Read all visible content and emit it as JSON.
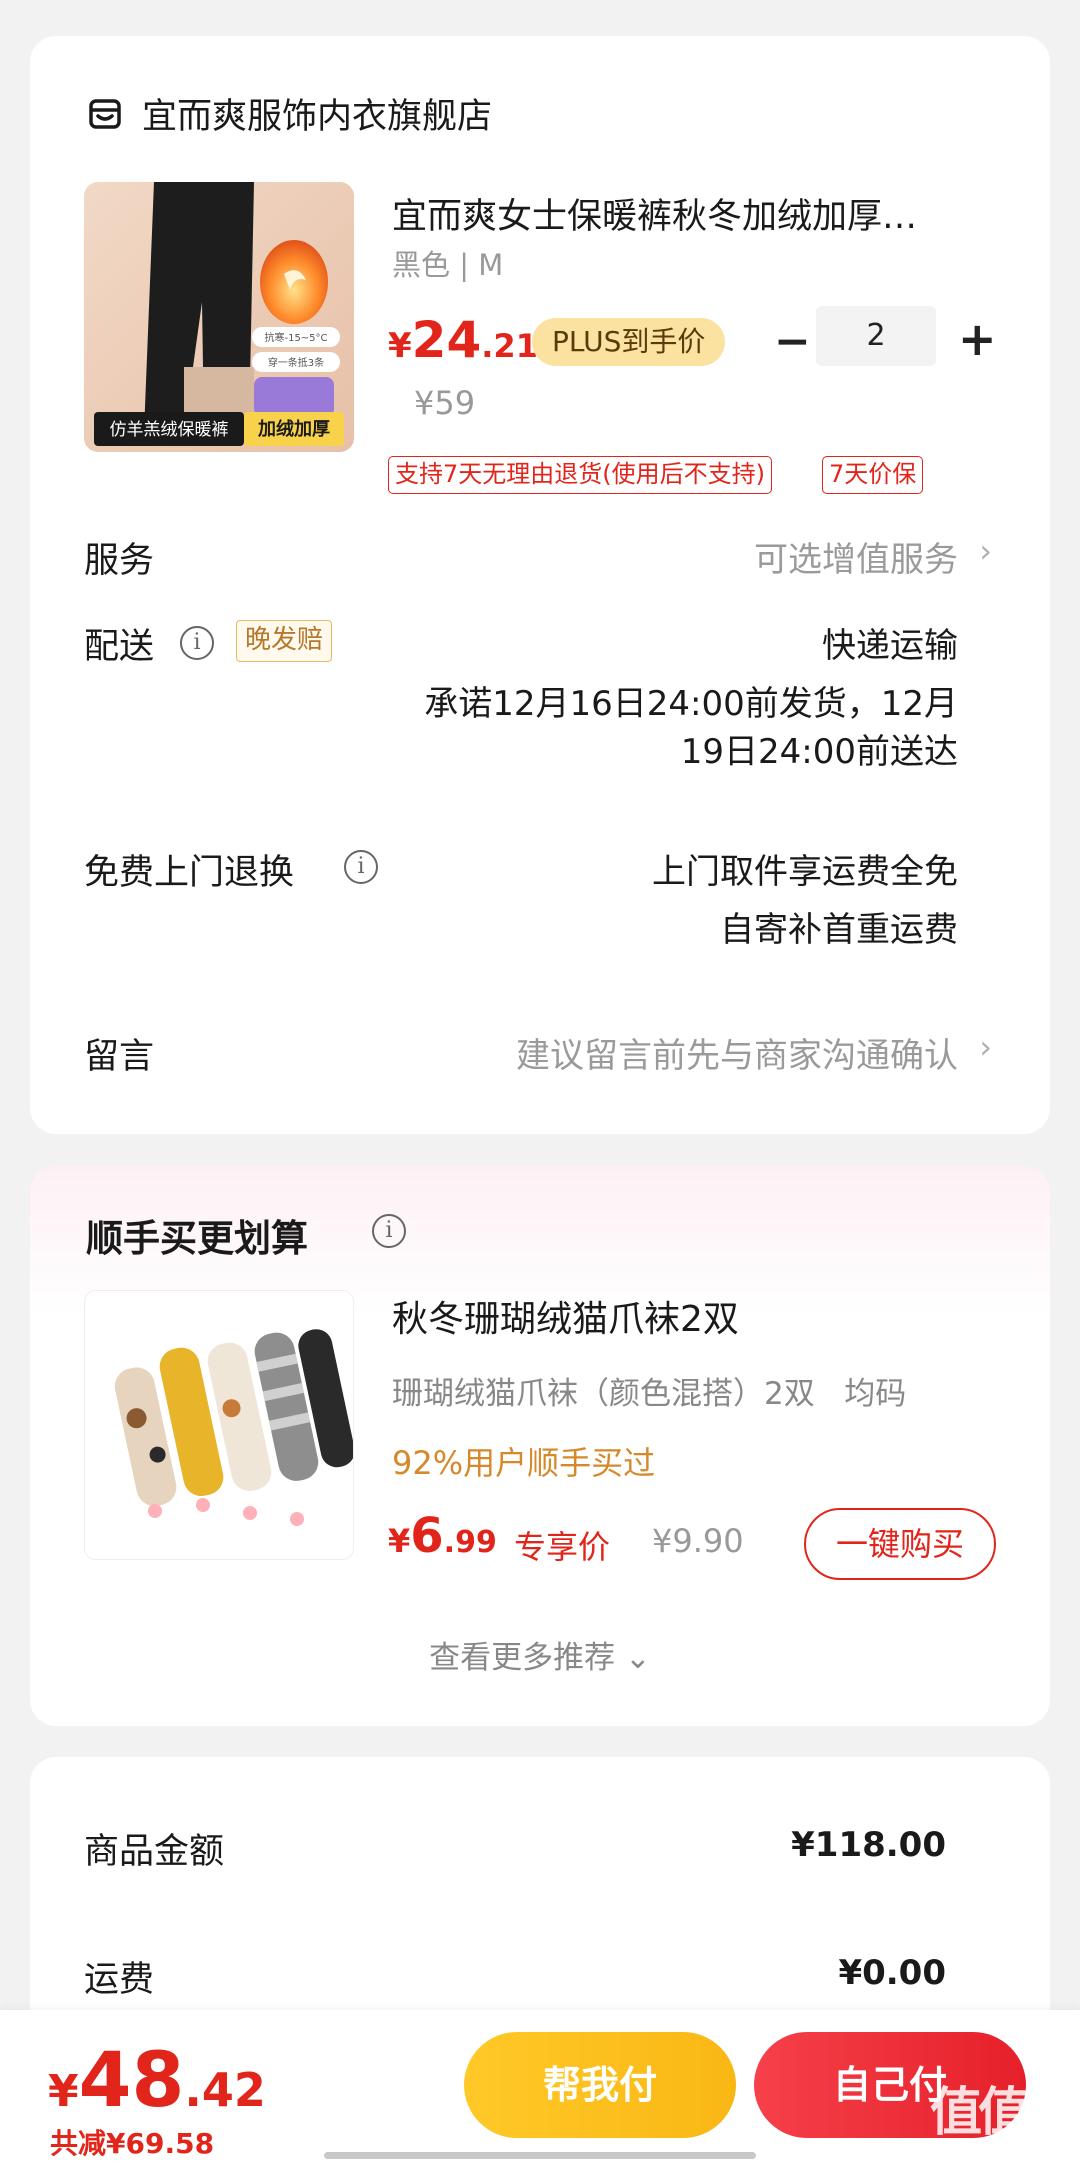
{
  "store": {
    "icon": "store-icon",
    "name": "宜而爽服饰内衣旗舰店"
  },
  "product": {
    "title": "宜而爽女士保暖裤秋冬加绒加厚…",
    "spec": "黑色 | M",
    "price_currency": "¥",
    "price_int": "24",
    "price_dec": ".21",
    "plus_tag": "PLUS到手价",
    "quantity": "2",
    "minus": "−",
    "plus": "+",
    "original_price": "¥59",
    "service_tags": [
      "支持7天无理由退货(使用后不支持)",
      "7天价保"
    ],
    "image": {
      "badge_left": "仿羊羔绒保暖裤",
      "badge_right": "加绒加厚",
      "bubble_line1": "抗寒-15~5°C",
      "bubble_line2": "穿一条抵3条"
    }
  },
  "rows": {
    "service_label": "服务",
    "service_value": "可选增值服务",
    "delivery_label": "配送",
    "delivery_tag": "晚发赔",
    "delivery_method": "快递运输",
    "delivery_line1": "承诺12月16日24:00前发货，12月",
    "delivery_line2": "19日24:00前送达",
    "return_label": "免费上门退换",
    "return_line1": "上门取件享运费全免",
    "return_line2": "自寄补首重运费",
    "message_label": "留言",
    "message_placeholder": "建议留言前先与商家沟通确认",
    "chevron": "›",
    "info": "i"
  },
  "recommend": {
    "title": "顺手买更划算",
    "name": "秋冬珊瑚绒猫爪袜2双",
    "spec": "珊瑚绒猫爪袜（颜色混搭）2双   均码",
    "social": "92%用户顺手买过",
    "price_currency": "¥",
    "price_int": "6",
    "price_dec": ".99",
    "exclusive_label": "专享价",
    "original_price": "¥9.90",
    "buy_label": "一键购买",
    "more_label": "查看更多推荐 ⌄"
  },
  "summary": {
    "goods_label": "商品金额",
    "goods_value": "¥118.00",
    "shipping_label": "运费",
    "shipping_value": "¥0.00"
  },
  "bottom": {
    "currency": "¥",
    "total_int": "48",
    "total_dec": ".42",
    "saved": "共减¥69.58",
    "help_pay": "帮我付",
    "self_pay": "自己付",
    "watermark": "值值值",
    "watermark_url": "zhizhizhi.com"
  },
  "colors": {
    "accent": "#e1251b",
    "plus_gold": "#fbe2a0",
    "yellow_btn": "#ffc928",
    "red_btn": "#f6404a"
  }
}
